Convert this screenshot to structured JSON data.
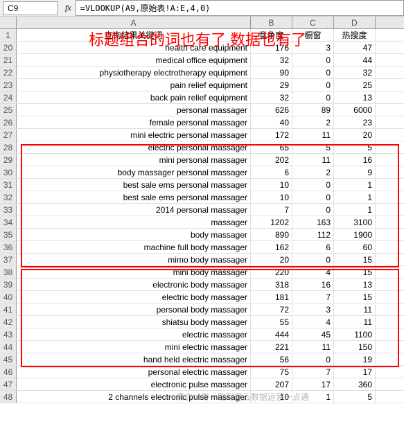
{
  "name_box": "C9",
  "fx_label": "fx",
  "formula": "=VLOOKUP(A9,原始表!A:E,4,0)",
  "annotation": "标题组合的词也有了,数据也有了",
  "col_letters": [
    "A",
    "B",
    "C",
    "D"
  ],
  "table_header": {
    "a": "查询结果关键词",
    "b": "竞争度",
    "c": "橱窗",
    "d": "热搜度"
  },
  "rows": [
    {
      "rh": "20",
      "a": "health care equipment",
      "b": "176",
      "c": "3",
      "d": "47"
    },
    {
      "rh": "21",
      "a": "medical office equipment",
      "b": "32",
      "c": "0",
      "d": "44"
    },
    {
      "rh": "22",
      "a": "physiotherapy electrotherapy equipment",
      "b": "90",
      "c": "0",
      "d": "32"
    },
    {
      "rh": "23",
      "a": "pain relief equipment",
      "b": "29",
      "c": "0",
      "d": "25"
    },
    {
      "rh": "24",
      "a": "back pain relief equipment",
      "b": "32",
      "c": "0",
      "d": "13"
    },
    {
      "rh": "25",
      "a": "personal massager",
      "b": "626",
      "c": "89",
      "d": "6000"
    },
    {
      "rh": "26",
      "a": "female personal massager",
      "b": "40",
      "c": "2",
      "d": "23"
    },
    {
      "rh": "27",
      "a": "mini electric personal massager",
      "b": "172",
      "c": "11",
      "d": "20"
    },
    {
      "rh": "28",
      "a": "electric personal massager",
      "b": "65",
      "c": "5",
      "d": "5"
    },
    {
      "rh": "29",
      "a": "mini personal massager",
      "b": "202",
      "c": "11",
      "d": "16"
    },
    {
      "rh": "30",
      "a": "body massager personal massager",
      "b": "6",
      "c": "2",
      "d": "9"
    },
    {
      "rh": "31",
      "a": "best sale ems personal massager",
      "b": "10",
      "c": "0",
      "d": "1"
    },
    {
      "rh": "32",
      "a": "best sale ems personal massager",
      "b": "10",
      "c": "0",
      "d": "1"
    },
    {
      "rh": "33",
      "a": "2014 personal massager",
      "b": "7",
      "c": "0",
      "d": "1"
    },
    {
      "rh": "34",
      "a": "massager",
      "b": "1202",
      "c": "163",
      "d": "3100"
    },
    {
      "rh": "35",
      "a": "body massager",
      "b": "890",
      "c": "112",
      "d": "1900"
    },
    {
      "rh": "36",
      "a": "machine full body massager",
      "b": "162",
      "c": "6",
      "d": "60"
    },
    {
      "rh": "37",
      "a": "mimo body massager",
      "b": "20",
      "c": "0",
      "d": "15"
    },
    {
      "rh": "38",
      "a": "mini body massager",
      "b": "220",
      "c": "4",
      "d": "15"
    },
    {
      "rh": "39",
      "a": "electronic body massager",
      "b": "318",
      "c": "16",
      "d": "13"
    },
    {
      "rh": "40",
      "a": "electric body massager",
      "b": "181",
      "c": "7",
      "d": "15"
    },
    {
      "rh": "41",
      "a": "personal body massager",
      "b": "72",
      "c": "3",
      "d": "11"
    },
    {
      "rh": "42",
      "a": "shiatsu body massager",
      "b": "55",
      "c": "4",
      "d": "11"
    },
    {
      "rh": "43",
      "a": "electric massager",
      "b": "444",
      "c": "45",
      "d": "1100"
    },
    {
      "rh": "44",
      "a": "mini electric massager",
      "b": "221",
      "c": "11",
      "d": "150"
    },
    {
      "rh": "45",
      "a": "hand held electric massager",
      "b": "56",
      "c": "0",
      "d": "19"
    },
    {
      "rh": "46",
      "a": "personal electric massager",
      "b": "75",
      "c": "7",
      "d": "17"
    },
    {
      "rh": "47",
      "a": "electronic pulse massager",
      "b": "207",
      "c": "17",
      "d": "360"
    },
    {
      "rh": "48",
      "a": "2 channels electronic pulse massager",
      "b": "10",
      "c": "1",
      "d": "5"
    }
  ],
  "watermark": "来自：零一路阿里云数据运营一点通"
}
